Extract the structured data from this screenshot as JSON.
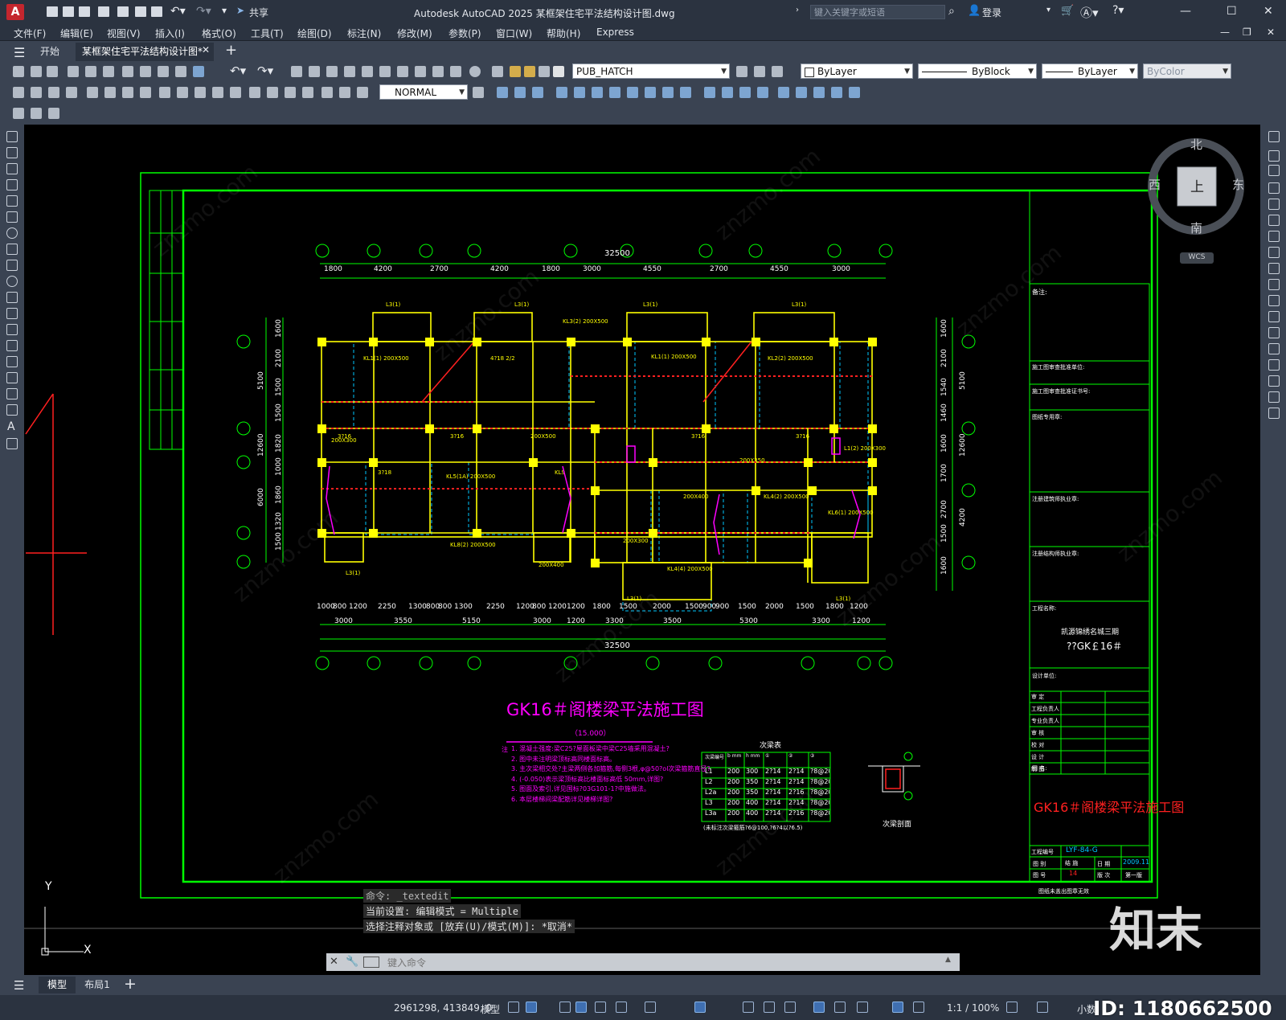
{
  "window": {
    "title": "Autodesk AutoCAD 2025    某框架住宅平法结构设计图.dwg",
    "search_placeholder": "键入关键字或短语",
    "login": "登录",
    "share": "共享",
    "logo": "A"
  },
  "menu": [
    "文件(F)",
    "编辑(E)",
    "视图(V)",
    "插入(I)",
    "格式(O)",
    "工具(T)",
    "绘图(D)",
    "标注(N)",
    "修改(M)",
    "参数(P)",
    "窗口(W)",
    "帮助(H)",
    "Express"
  ],
  "tabs": {
    "start": "开始",
    "document": "某框架住宅平法结构设计图*"
  },
  "toolbar": {
    "layer": "PUB_HATCH",
    "color": "ByLayer",
    "linetype": "ByBlock",
    "lineweight": "ByLayer",
    "plotstyle": "ByColor",
    "dimstyle": "NORMAL"
  },
  "viewcube": {
    "north": "北",
    "south": "南",
    "west": "西",
    "east": "东",
    "top": "上",
    "wcs": "WCS"
  },
  "drawing": {
    "overall_dim": "32500",
    "top_dims": [
      "1800",
      "4200",
      "2700",
      "4200",
      "1800",
      "3000",
      "4550",
      "2700",
      "4550",
      "3000"
    ],
    "bottom_dims_row1": [
      "1000",
      "800",
      "1200",
      "2250",
      "1300",
      "800",
      "800",
      "1300",
      "2250",
      "1200",
      "800",
      "1200",
      "1200",
      "1800",
      "1500",
      "2000",
      "1500",
      "900",
      "900",
      "1500",
      "2000",
      "1500",
      "1800",
      "1200"
    ],
    "bottom_dims_row2": [
      "3000",
      "3550",
      "5150",
      "3000",
      "1200",
      "3300",
      "3500",
      "5300",
      "3300",
      "1200"
    ],
    "left_dims": [
      "1600",
      "2100",
      "1500",
      "1500",
      "1820",
      "1000",
      "1860",
      "1320",
      "1500"
    ],
    "left_totals": [
      "5100",
      "12600",
      "6000"
    ],
    "right_dims": [
      "1600",
      "2100",
      "1540",
      "1460",
      "1600",
      "1700",
      "2700",
      "1500",
      "1600"
    ],
    "right_totals": [
      "5100",
      "12600",
      "4200"
    ],
    "plan_title": "GK16＃阁楼梁平法施工图",
    "plan_elev": "（15.000）",
    "notes_label": "注",
    "notes": [
      "1. 混凝土强度:梁C25?屋面板梁中梁C25墙采用混凝土?",
      "2. 图中未注明梁顶标高同楼面标高。",
      "3. 主次梁相交处?主梁两侧各加箍筋,每侧3根,φ@50?ol次梁箍筋直径?",
      "4. (-0.050)表示梁顶标高比楼面标高低 50mm,详图?",
      "5. 图面及索引,详见国标?03G101-1?中施做法。",
      "6. 本层楼梯间梁配筋详见楼梯详图?"
    ],
    "table_title": "次梁表",
    "table_headers": [
      "次梁编号 LX",
      "b mm",
      "h mm",
      "①",
      "②",
      "③"
    ],
    "table_rows": [
      [
        "L1",
        "200",
        "300",
        "2?14",
        "2?14",
        "?8@200"
      ],
      [
        "L2",
        "200",
        "350",
        "2?14",
        "2?14",
        "?8@200"
      ],
      [
        "L2a",
        "200",
        "350",
        "2?14",
        "2?16",
        "?8@200"
      ],
      [
        "L3",
        "200",
        "400",
        "2?14",
        "2?14",
        "?8@200"
      ],
      [
        "L3a",
        "200",
        "400",
        "2?14",
        "2?16",
        "?8@200"
      ]
    ],
    "table_note": "(未标注次梁箍筋?6@100,?6?4以?6.5)",
    "section_label": "次梁剖面",
    "ucs_x": "X",
    "ucs_y": "Y"
  },
  "titleblock": {
    "remarks": "备注:",
    "review_units": [
      "施工图审查批准单位:",
      "施工图审查批准证书号:"
    ],
    "stamp": "图纸专用章:",
    "registered1": "注册建筑师执业章:",
    "registered2": "注册结构师执业章:",
    "project_name_label": "工程名称:",
    "project_name": "凯源锦绣名城三期",
    "project_sub": "??GK￡16＃",
    "design_unit": "设计单位:",
    "roles": [
      "审 定",
      "工程负责人",
      "专业负责人",
      "审 核",
      "校 对",
      "设 计",
      "制 图"
    ],
    "drawing_name_label": "图 名:",
    "drawing_name": "GK16＃阁楼梁平法施工图",
    "project_no_label": "工程编号",
    "project_no": "LYF-84-G",
    "cat_label": "图 别",
    "cat": "结 施",
    "date_label": "日 期",
    "date": "2009.11",
    "sheet_label": "图 号",
    "sheet": "14",
    "edition_label": "版 次",
    "edition": "第一版",
    "footer": "图纸未盖出图章无效"
  },
  "command": {
    "history": [
      "命令: _textedit",
      "当前设置: 编辑模式 = Multiple",
      "选择注释对象或 [放弃(U)/模式(M)]: *取消*"
    ],
    "placeholder": "键入命令"
  },
  "layout_tabs": [
    "模型",
    "布局1"
  ],
  "status": {
    "coords": "2961298, 413849, 0",
    "model": "模型",
    "scale": "1:1 / 100%",
    "units": "小数"
  },
  "watermark": {
    "brand": "知末",
    "id": "ID: 1180662500",
    "site": "znzmo.com"
  },
  "colors": {
    "frame": "#00ff00",
    "title_text": "#ff00ff",
    "columns": "#ffff00",
    "hatch": "#ff0000",
    "beam": "#ffff00"
  }
}
